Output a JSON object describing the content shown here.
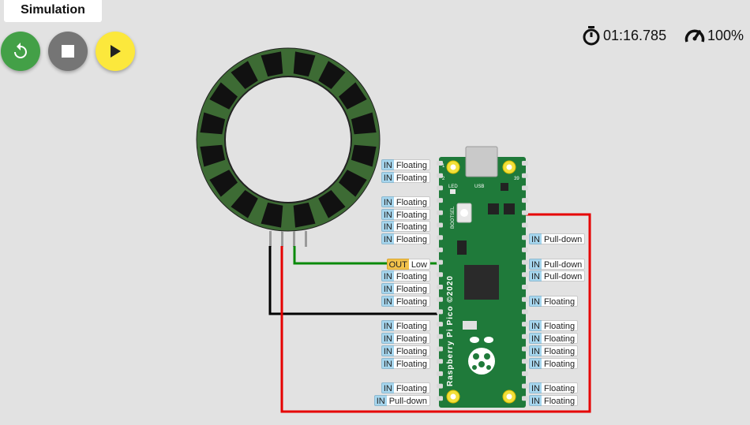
{
  "tab": {
    "label": "Simulation"
  },
  "controls": {
    "restart": {
      "color": "#43a047"
    },
    "stop": {
      "color": "#757575"
    },
    "play": {
      "color": "#fce83c"
    }
  },
  "status": {
    "time": "01:16.785",
    "speed": "100%"
  },
  "board": {
    "silkscreen_title": "Raspberry Pi Pico ©2020",
    "bootsel": "BOOTSEL",
    "led": "LED",
    "usb": "USB",
    "pin_1": "1",
    "pin_2": "2",
    "pin_39": "39"
  },
  "pins_left": [
    {
      "mode": "IN",
      "state": "Floating"
    },
    {
      "mode": "IN",
      "state": "Floating"
    },
    {
      "mode": "IN",
      "state": "Floating"
    },
    {
      "mode": "IN",
      "state": "Floating"
    },
    {
      "mode": "IN",
      "state": "Floating"
    },
    {
      "mode": "IN",
      "state": "Floating"
    },
    {
      "mode": "OUT",
      "state": "Low"
    },
    {
      "mode": "IN",
      "state": "Floating"
    },
    {
      "mode": "IN",
      "state": "Floating"
    },
    {
      "mode": "IN",
      "state": "Floating"
    },
    {
      "mode": "IN",
      "state": "Floating"
    },
    {
      "mode": "IN",
      "state": "Floating"
    },
    {
      "mode": "IN",
      "state": "Floating"
    },
    {
      "mode": "IN",
      "state": "Floating"
    },
    {
      "mode": "IN",
      "state": "Floating"
    },
    {
      "mode": "IN",
      "state": "Pull-down"
    }
  ],
  "pins_right": [
    {
      "mode": "IN",
      "state": "Pull-down"
    },
    {
      "mode": "IN",
      "state": "Pull-down"
    },
    {
      "mode": "IN",
      "state": "Pull-down"
    },
    {
      "mode": "IN",
      "state": "Floating"
    },
    {
      "mode": "IN",
      "state": "Floating"
    },
    {
      "mode": "IN",
      "state": "Floating"
    },
    {
      "mode": "IN",
      "state": "Floating"
    },
    {
      "mode": "IN",
      "state": "Floating"
    },
    {
      "mode": "IN",
      "state": "Floating"
    },
    {
      "mode": "IN",
      "state": "Floating"
    }
  ],
  "wires": {
    "signal": "#0a8a0a",
    "ground": "#000000",
    "power": "#e60000"
  }
}
